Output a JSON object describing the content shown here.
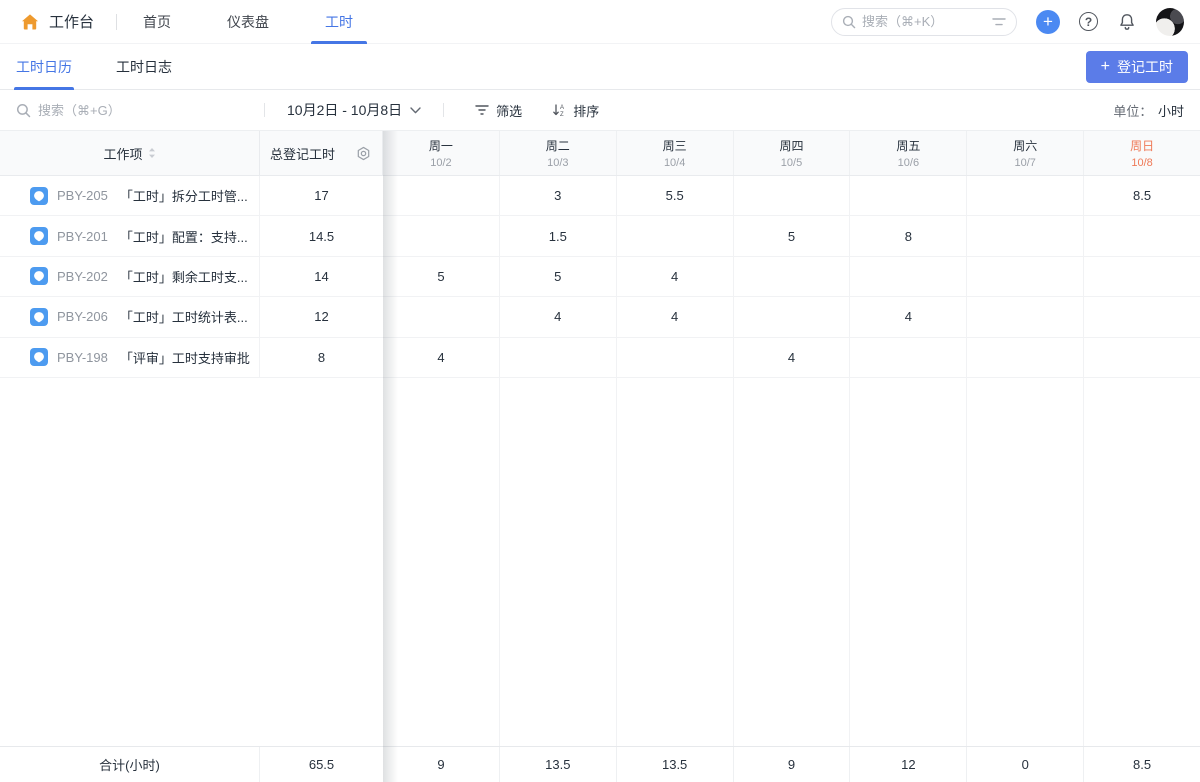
{
  "topbar": {
    "brand_label": "工作台",
    "nav": [
      {
        "label": "首页",
        "active": false
      },
      {
        "label": "仪表盘",
        "active": false
      },
      {
        "label": "工时",
        "active": true
      }
    ],
    "search_placeholder": "搜索（⌘+K）",
    "help_glyph": "?",
    "plus_glyph": "+"
  },
  "tabs": [
    {
      "label": "工时日历",
      "active": true
    },
    {
      "label": "工时日志",
      "active": false
    }
  ],
  "actions": {
    "register_plus": "+",
    "register_label": "登记工时"
  },
  "toolbar": {
    "search_placeholder": "搜索（⌘+G）",
    "date_range": "10月2日 - 10月8日",
    "filter_label": "筛选",
    "sort_label": "排序",
    "unit_label": "单位：",
    "unit_value": "小时"
  },
  "table": {
    "item_header": "工作项",
    "total_header": "总登记工时",
    "days": [
      {
        "weekday": "周一",
        "date": "10/2",
        "highlight": false
      },
      {
        "weekday": "周二",
        "date": "10/3",
        "highlight": false
      },
      {
        "weekday": "周三",
        "date": "10/4",
        "highlight": false
      },
      {
        "weekday": "周四",
        "date": "10/5",
        "highlight": false
      },
      {
        "weekday": "周五",
        "date": "10/6",
        "highlight": false
      },
      {
        "weekday": "周六",
        "date": "10/7",
        "highlight": false
      },
      {
        "weekday": "周日",
        "date": "10/8",
        "highlight": true
      }
    ],
    "rows": [
      {
        "id": "PBY-205",
        "title": "「工时」拆分工时管...",
        "total": "17",
        "cells": [
          "",
          "3",
          "5.5",
          "",
          "",
          "",
          "8.5"
        ]
      },
      {
        "id": "PBY-201",
        "title": "「工时」配置：支持...",
        "total": "14.5",
        "cells": [
          "",
          "1.5",
          "",
          "5",
          "8",
          "",
          ""
        ]
      },
      {
        "id": "PBY-202",
        "title": "「工时」剩余工时支...",
        "total": "14",
        "cells": [
          "5",
          "5",
          "4",
          "",
          "",
          "",
          ""
        ]
      },
      {
        "id": "PBY-206",
        "title": "「工时」工时统计表...",
        "total": "12",
        "cells": [
          "",
          "4",
          "4",
          "",
          "4",
          "",
          ""
        ]
      },
      {
        "id": "PBY-198",
        "title": "「评审」工时支持审批",
        "total": "8",
        "cells": [
          "4",
          "",
          "",
          "4",
          "",
          "",
          ""
        ]
      }
    ],
    "footer": {
      "label": "合计(小时)",
      "total": "65.5",
      "cells": [
        "9",
        "13.5",
        "13.5",
        "9",
        "12",
        "0",
        "8.5"
      ]
    }
  },
  "colors": {
    "accent_blue": "#4576e5",
    "button_blue": "#5b7ce8",
    "plus_circle_blue": "#4b89f2",
    "item_icon_blue": "#4d9bf0",
    "sunday_orange": "#ef7a58",
    "home_icon_orange": "#ee9a2e"
  }
}
